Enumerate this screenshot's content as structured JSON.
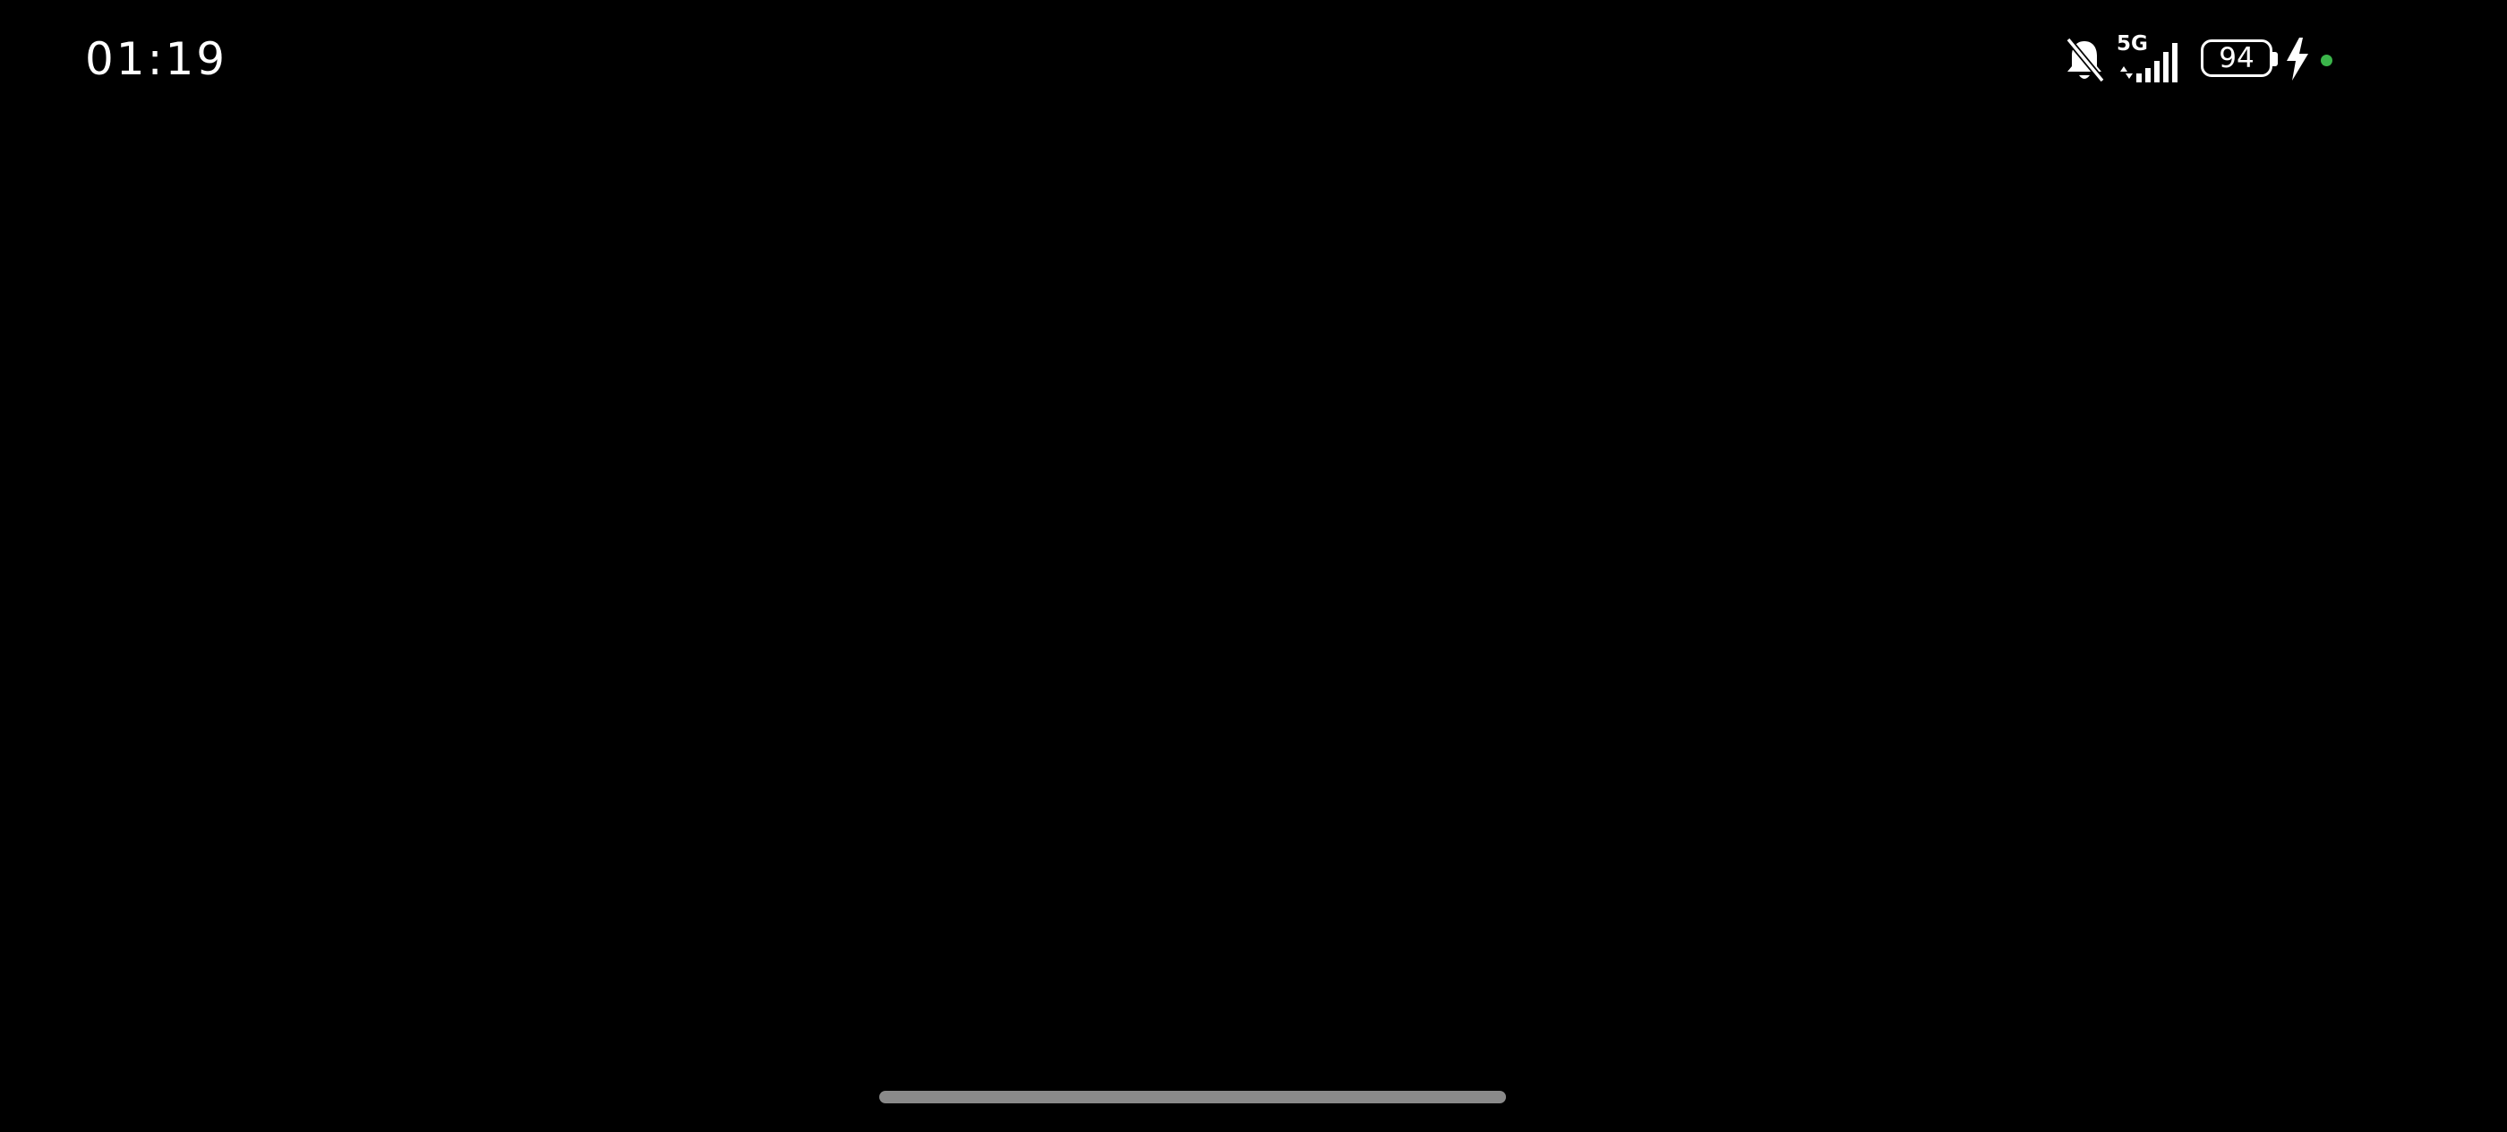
{
  "status_bar": {
    "time": "01:19",
    "network": "5G",
    "battery_level": "94",
    "icons": {
      "silent": "bell-off-icon",
      "signal": "cellular-signal-icon",
      "battery": "battery-icon",
      "charging": "charging-bolt-icon",
      "indicator": "privacy-dot-icon"
    },
    "indicator_color": "#3bb54a"
  },
  "colors": {
    "background": "#000000",
    "foreground": "#ffffff",
    "home_indicator": "#8a8a8a"
  }
}
